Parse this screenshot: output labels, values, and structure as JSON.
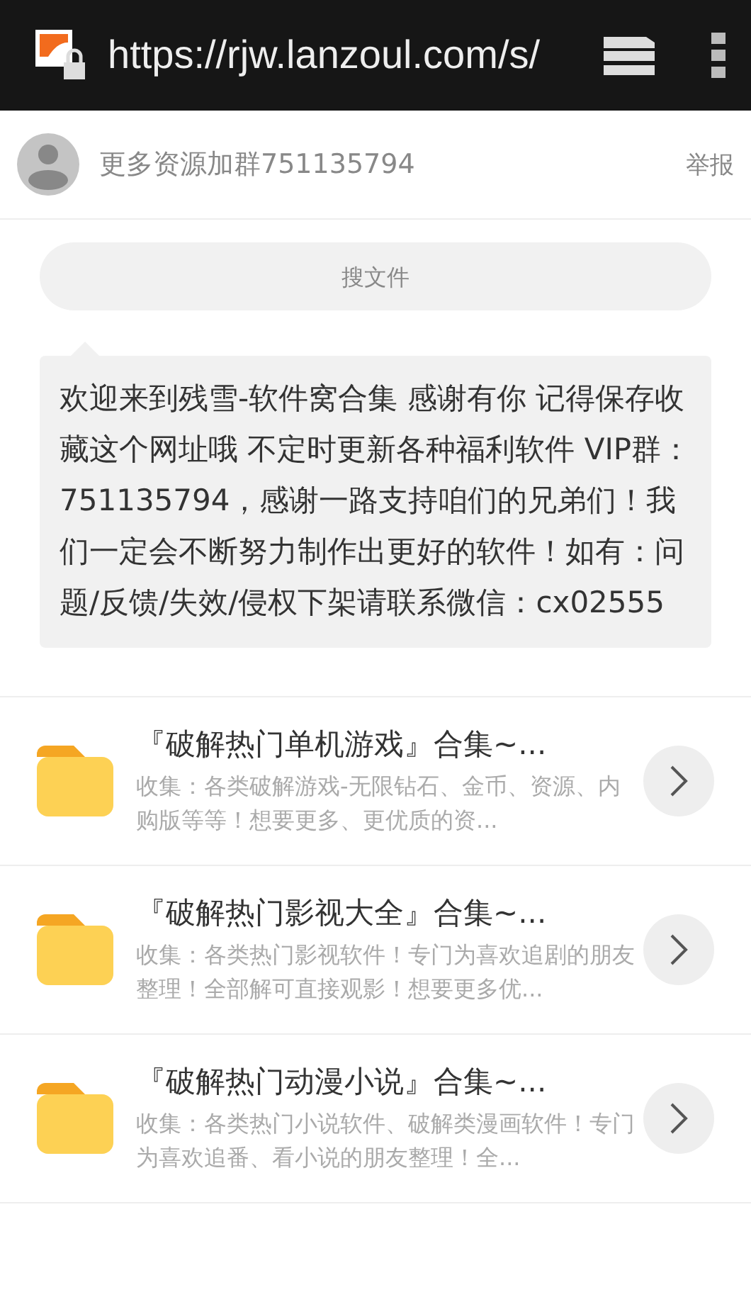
{
  "browser_bar": {
    "url": "https://rjw.lanzoul.com/s/"
  },
  "header": {
    "group_text": "更多资源加群751135794",
    "report_link": "举报"
  },
  "search": {
    "placeholder": "搜文件"
  },
  "announcement": "欢迎来到残雪-软件窝合集 感谢有你 记得保存收藏这个网址哦 不定时更新各种福利软件 VIP群：751135794，感谢一路支持咱们的兄弟们！我们一定会不断努力制作出更好的软件！如有：问题/反馈/失效/侵权下架请联系微信：cx02555",
  "folders": [
    {
      "title": "『破解热门单机游戏』合集~...",
      "description": "收集：各类破解游戏-无限钻石、金币、资源、内购版等等！想要更多、更优质的资..."
    },
    {
      "title": "『破解热门影视大全』合集~...",
      "description": "收集：各类热门影视软件！专门为喜欢追剧的朋友整理！全部解可直接观影！想要更多优..."
    },
    {
      "title": "『破解热门动漫小说』合集~...",
      "description": "收集：各类热门小说软件、破解类漫画软件！专门为喜欢追番、看小说的朋友整理！全..."
    }
  ]
}
